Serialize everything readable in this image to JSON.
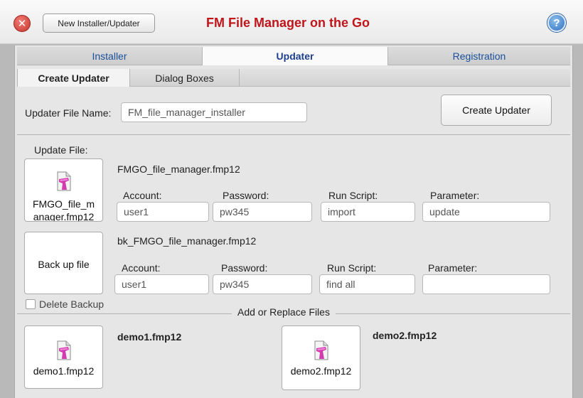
{
  "header": {
    "new_installer_label": "New Installer/Updater",
    "title": "FM File Manager on the Go",
    "help_label": "?",
    "close_label": "✕"
  },
  "main_tabs": [
    {
      "label": "Installer"
    },
    {
      "label": "Updater"
    },
    {
      "label": "Registration"
    }
  ],
  "sub_tabs": [
    {
      "label": "Create Updater"
    },
    {
      "label": "Dialog Boxes"
    }
  ],
  "updater_file": {
    "label": "Updater File Name:",
    "value": "FM_file_manager_installer",
    "create_button_label": "Create Updater"
  },
  "update_file": {
    "label": "Update File:",
    "box_caption": "FMGO_file_m anager.fmp12",
    "filename": "FMGO_file_manager.fmp12",
    "fields": {
      "account_label": "Account:",
      "account_value": "user1",
      "password_label": "Password:",
      "password_value": "pw345",
      "run_script_label": "Run Script:",
      "run_script_value": "import",
      "parameter_label": "Parameter:",
      "parameter_value": "update"
    }
  },
  "backup_file": {
    "box_caption": "Back up file",
    "filename": "bk_FMGO_file_manager.fmp12",
    "fields": {
      "account_label": "Account:",
      "account_value": "user1",
      "password_label": "Password:",
      "password_value": "pw345",
      "run_script_label": "Run Script:",
      "run_script_value": "find all",
      "parameter_label": "Parameter:",
      "parameter_value": ""
    },
    "delete_backup_label": "Delete Backup"
  },
  "add_replace": {
    "title": "Add or Replace Files",
    "files": [
      {
        "title": "demo1.fmp12",
        "caption": "demo1.fmp12"
      },
      {
        "title": "demo2.fmp12",
        "caption": "demo2.fmp12"
      }
    ]
  },
  "colors": {
    "title_red": "#c0161b",
    "tab_blue": "#1a4f9c",
    "file_icon_magenta": "#d43bb0"
  }
}
